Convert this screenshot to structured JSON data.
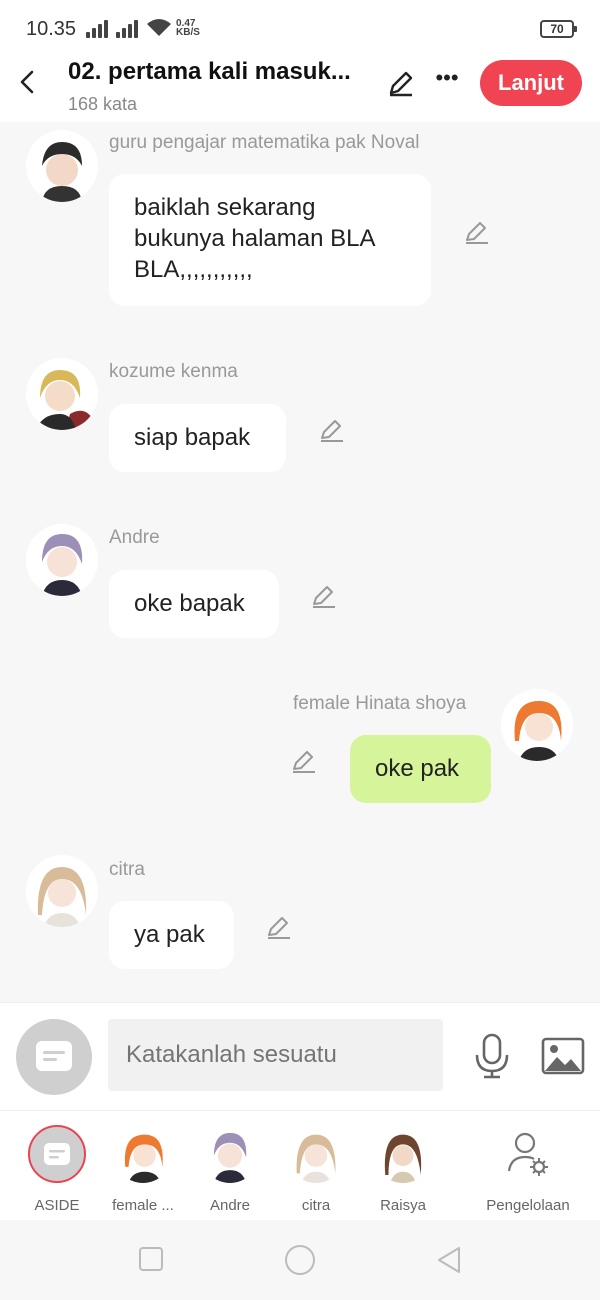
{
  "status": {
    "time": "10.35",
    "net_speed_value": "0.47",
    "net_speed_unit": "KB/S",
    "battery": "70"
  },
  "header": {
    "title": "02. pertama kali masuk...",
    "word_count": "168 kata",
    "next_label": "Lanjut"
  },
  "messages": [
    {
      "sender": "guru pengajar matematika pak Noval",
      "text": "baiklah sekarang bukunya halaman BLA BLA,,,,,,,,,,,",
      "side": "left",
      "avatar": "dark-haired-boy-avatar"
    },
    {
      "sender": "kozume kenma",
      "text": "siap bapak",
      "side": "left",
      "avatar": "blonde-boy-avatar"
    },
    {
      "sender": "Andre",
      "text": "oke bapak",
      "side": "left",
      "avatar": "lavender-haired-boy-avatar"
    },
    {
      "sender": "female Hinata shoya",
      "text": "oke pak",
      "side": "right",
      "avatar": "orange-haired-girl-avatar"
    },
    {
      "sender": "citra",
      "text": "ya pak",
      "side": "left",
      "avatar": "light-haired-girl-avatar"
    }
  ],
  "input": {
    "placeholder": "Katakanlah sesuatu"
  },
  "characters": [
    {
      "label": "ASIDE"
    },
    {
      "label": "female ..."
    },
    {
      "label": "Andre"
    },
    {
      "label": "citra"
    },
    {
      "label": "Raisya"
    },
    {
      "label": "Pengelolaan"
    }
  ],
  "colors": {
    "accent": "#f04452",
    "my_bubble": "#d6f59a",
    "background": "#f7f7f7"
  }
}
